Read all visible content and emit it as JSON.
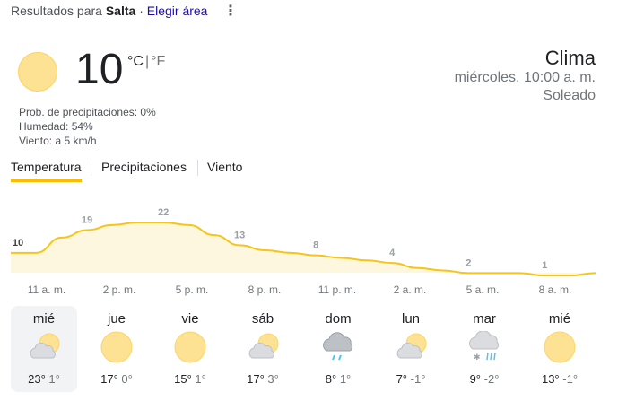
{
  "header": {
    "results_prefix": "Resultados para",
    "location": "Salta",
    "separator": "·",
    "choose_area": "Elegir área",
    "menu_icon": "more-vert-icon"
  },
  "current": {
    "icon": "sun-icon",
    "temperature": "10",
    "unit_c": "°C",
    "unit_sep": "|",
    "unit_f": "°F",
    "precip": "Prob. de precipitaciones: 0%",
    "humidity": "Humedad: 54%",
    "wind": "Viento: a 5 km/h",
    "title": "Clima",
    "datetime": "miércoles, 10:00 a. m.",
    "condition": "Soleado"
  },
  "tabs": [
    {
      "label": "Temperatura",
      "active": true
    },
    {
      "label": "Precipitaciones",
      "active": false
    },
    {
      "label": "Viento",
      "active": false
    }
  ],
  "colors": {
    "accent": "#fbbc04",
    "fill": "#fef7e0",
    "sun": "#fde293",
    "line": "#f5c518"
  },
  "chart_data": {
    "type": "area",
    "x": [
      "10 a. m.",
      "11 a. m.",
      "12 p. m.",
      "1 p. m.",
      "2 p. m.",
      "3 p. m.",
      "4 p. m.",
      "5 p. m.",
      "6 p. m.",
      "7 p. m.",
      "8 p. m.",
      "9 p. m.",
      "10 p. m.",
      "11 p. m.",
      "12 a. m.",
      "1 a. m.",
      "2 a. m.",
      "3 a. m.",
      "4 a. m.",
      "5 a. m.",
      "6 a. m.",
      "7 a. m.",
      "8 a. m.",
      "9 a. m."
    ],
    "values": [
      10,
      10,
      16,
      19,
      21,
      22,
      22,
      21,
      17,
      13,
      11,
      10,
      9,
      8,
      7,
      6,
      4,
      3,
      2,
      2,
      2,
      1,
      1,
      2
    ],
    "labels": [
      {
        "index": 0,
        "text": "10"
      },
      {
        "index": 3,
        "text": "19"
      },
      {
        "index": 6,
        "text": "22"
      },
      {
        "index": 9,
        "text": "13"
      },
      {
        "index": 12,
        "text": "8"
      },
      {
        "index": 15,
        "text": "4"
      },
      {
        "index": 18,
        "text": "2"
      },
      {
        "index": 21,
        "text": "1"
      }
    ],
    "tick_labels": [
      "11 a. m.",
      "2 p. m.",
      "5 p. m.",
      "8 p. m.",
      "11 p. m.",
      "2 a. m.",
      "5 a. m.",
      "8 a. m."
    ],
    "grid": false
  },
  "days": [
    {
      "name": "mié",
      "icon": "partly-cloudy-icon",
      "high": "23°",
      "low": "1°",
      "selected": true
    },
    {
      "name": "jue",
      "icon": "sun-icon",
      "high": "17°",
      "low": "0°",
      "selected": false
    },
    {
      "name": "vie",
      "icon": "sun-icon",
      "high": "15°",
      "low": "1°",
      "selected": false
    },
    {
      "name": "sáb",
      "icon": "partly-cloudy-icon",
      "high": "17°",
      "low": "3°",
      "selected": false
    },
    {
      "name": "dom",
      "icon": "rain-icon",
      "high": "8°",
      "low": "1°",
      "selected": false
    },
    {
      "name": "lun",
      "icon": "partly-cloudy-icon",
      "high": "7°",
      "low": "-1°",
      "selected": false
    },
    {
      "name": "mar",
      "icon": "snow-rain-icon",
      "high": "9°",
      "low": "-2°",
      "selected": false
    },
    {
      "name": "mié",
      "icon": "sun-icon",
      "high": "13°",
      "low": "-1°",
      "selected": false
    }
  ]
}
